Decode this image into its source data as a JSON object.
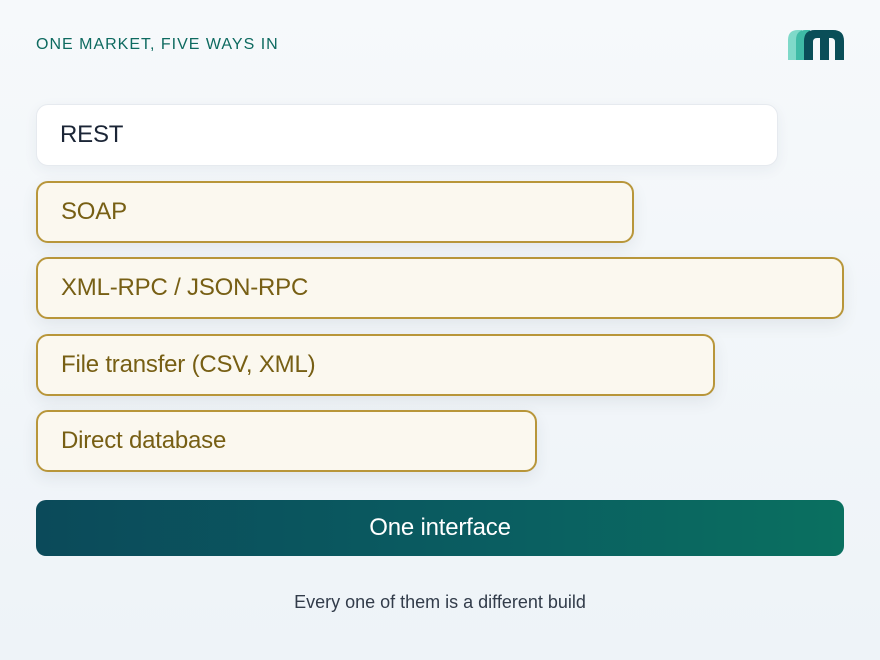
{
  "heading": "ONE MARKET, FIVE WAYS IN",
  "logo_icon": "m-logo-icon",
  "options": [
    {
      "label": "REST",
      "selected": true
    },
    {
      "label": "SOAP",
      "selected": false
    },
    {
      "label": "XML-RPC / JSON-RPC",
      "selected": false
    },
    {
      "label": "File transfer (CSV, XML)",
      "selected": false
    },
    {
      "label": "Direct database",
      "selected": false
    }
  ],
  "cta_label": "One interface",
  "footnote": "Every one of them is a different build",
  "colors": {
    "accent": "#0e6a60",
    "option_border": "#b8963a",
    "option_text": "#775f14",
    "cta_start": "#0b4a5a",
    "cta_end": "#0a7060"
  }
}
